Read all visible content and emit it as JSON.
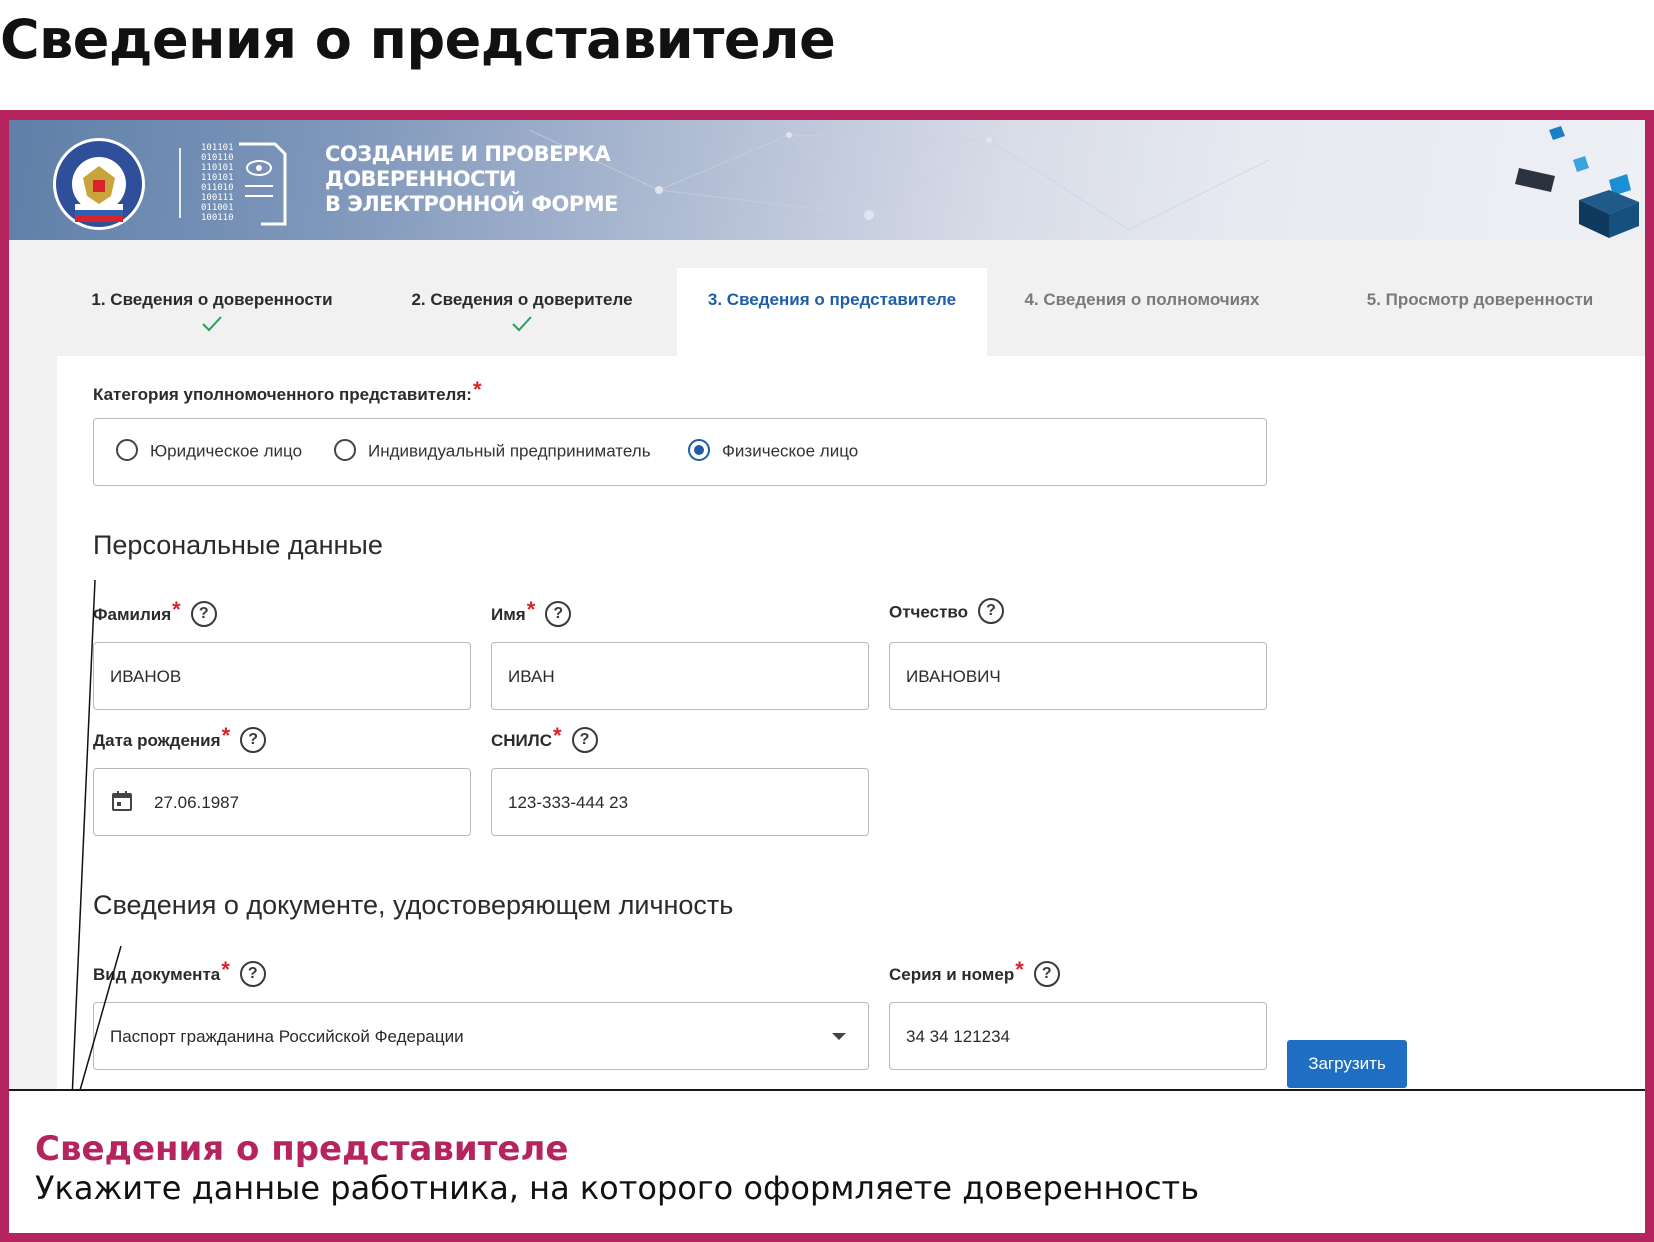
{
  "page_title": "Сведения о представителе",
  "banner": {
    "title_line1": "Создание и проверка",
    "title_line2": "доверенности",
    "title_line3": "в электронной форме",
    "binary_text": [
      "101101",
      "010110",
      "110101",
      "110101",
      "011010",
      "100111",
      "011001",
      "100110"
    ]
  },
  "tabs": [
    {
      "label": "1. Сведения о доверенности",
      "state": "completed"
    },
    {
      "label": "2. Сведения о доверителе",
      "state": "completed"
    },
    {
      "label": "3. Сведения о представителе",
      "state": "active"
    },
    {
      "label": "4. Сведения о полномочиях",
      "state": "disabled"
    },
    {
      "label": "5. Просмотр доверенности",
      "state": "disabled"
    }
  ],
  "form": {
    "category_label": "Категория уполномоченного представителя:",
    "required_mark": "*",
    "help_mark": "?",
    "options": [
      "Юридическое лицо",
      "Индивидуальный предприниматель",
      "Физическое лицо"
    ],
    "selected_option": "Физическое лицо",
    "personal_heading": "Персональные данные",
    "surname_label": "Фамилия",
    "surname_value": "ИВАНОВ",
    "name_label": "Имя",
    "name_value": "ИВАН",
    "patronymic_label": "Отчество",
    "patronymic_value": "ИВАНОВИЧ",
    "birth_label": "Дата рождения",
    "birth_value": "27.06.1987",
    "snils_label": "СНИЛС",
    "snils_value": "123-333-444 23",
    "document_heading": "Сведения о документе, удостоверяющем личность",
    "doc_type_label": "Вид документа",
    "doc_type_value": "Паспорт гражданина Российской Федерации",
    "series_label": "Серия и номер",
    "series_value": "34 34 121234",
    "upload_button": "Загрузить"
  },
  "callout": {
    "title": "Сведения о представителе",
    "text": "Укажите данные работника, на которого оформляете доверенность"
  },
  "colors": {
    "frame": "#b5245e",
    "accent_blue": "#1e5ea8",
    "button_blue": "#1e6fc4",
    "required_red": "#d8232a",
    "check_green": "#2e9d5a"
  }
}
